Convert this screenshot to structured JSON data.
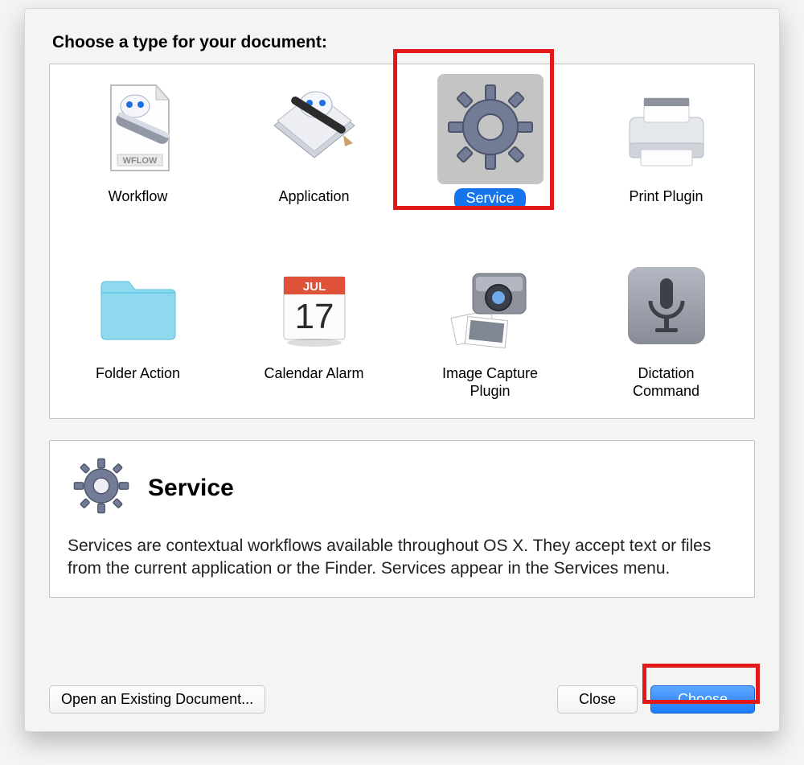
{
  "heading": "Choose a type for your document:",
  "types": [
    {
      "id": "workflow",
      "label": "Workflow"
    },
    {
      "id": "application",
      "label": "Application"
    },
    {
      "id": "service",
      "label": "Service",
      "selected": true
    },
    {
      "id": "print-plugin",
      "label": "Print Plugin"
    },
    {
      "id": "folder-action",
      "label": "Folder Action"
    },
    {
      "id": "calendar-alarm",
      "label": "Calendar Alarm",
      "calendar": {
        "month": "JUL",
        "day": "17"
      }
    },
    {
      "id": "image-capture-plugin",
      "label": "Image Capture\nPlugin"
    },
    {
      "id": "dictation-command",
      "label": "Dictation\nCommand"
    }
  ],
  "description": {
    "title": "Service",
    "body": "Services are contextual workflows available throughout OS X. They accept text or files from the current application or the Finder. Services appear in the Services menu."
  },
  "buttons": {
    "open": "Open an Existing Document...",
    "close": "Close",
    "choose": "Choose"
  }
}
